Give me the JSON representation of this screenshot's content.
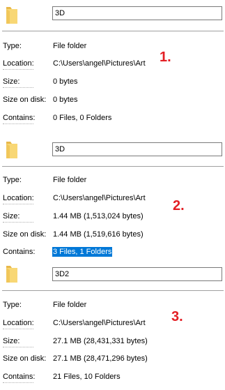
{
  "panels": [
    {
      "folder_name": "3D",
      "marker": "1.",
      "rows": [
        {
          "label": "Type:",
          "value": "File folder"
        },
        {
          "label": "Location:",
          "value": "C:\\Users\\angel\\Pictures\\Art"
        },
        {
          "label": "Size:",
          "value": "0 bytes"
        },
        {
          "label": "Size on disk:",
          "value": "0 bytes"
        },
        {
          "label": "Contains:",
          "value": "0 Files, 0 Folders"
        }
      ]
    },
    {
      "folder_name": "3D",
      "marker": "2.",
      "rows": [
        {
          "label": "Type:",
          "value": "File folder"
        },
        {
          "label": "Location:",
          "value": "C:\\Users\\angel\\Pictures\\Art"
        },
        {
          "label": "Size:",
          "value": "1.44 MB (1,513,024 bytes)"
        },
        {
          "label": "Size on disk:",
          "value": "1.44 MB (1,519,616 bytes)"
        },
        {
          "label": "Contains:",
          "value": "3 Files, 1 Folders"
        }
      ]
    },
    {
      "folder_name": "3D2",
      "marker": "3.",
      "rows": [
        {
          "label": "Type:",
          "value": "File folder"
        },
        {
          "label": "Location:",
          "value": "C:\\Users\\angel\\Pictures\\Art"
        },
        {
          "label": "Size:",
          "value": "27.1 MB (28,431,331 bytes)"
        },
        {
          "label": "Size on disk:",
          "value": "27.1 MB (28,471,296 bytes)"
        },
        {
          "label": "Contains:",
          "value": "21 Files, 10 Folders"
        }
      ]
    }
  ],
  "colors": {
    "marker": "#e31e24",
    "selection": "#0078d7",
    "folder": "#f8d775"
  },
  "icons": {
    "folder": "folder-icon"
  }
}
